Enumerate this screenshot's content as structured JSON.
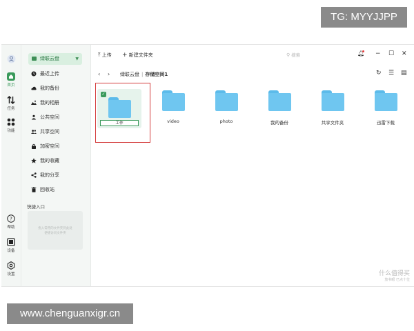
{
  "overlay": {
    "tg": "TG: MYYJJPP",
    "url": "www.chenguanxigr.cn"
  },
  "rail": [
    {
      "label": "",
      "icon": "user-icon"
    },
    {
      "label": "首页",
      "icon": "home-icon"
    },
    {
      "label": "任务",
      "icon": "transfer-icon"
    },
    {
      "label": "功能",
      "icon": "grid-icon"
    },
    {
      "label": "帮助",
      "icon": "help-icon"
    },
    {
      "label": "设备",
      "icon": "device-icon"
    },
    {
      "label": "设置",
      "icon": "settings-icon"
    }
  ],
  "sidebar": {
    "drive": "绿联云盘",
    "items": [
      {
        "label": "最近上传",
        "icon": "clock-icon"
      },
      {
        "label": "我的备份",
        "icon": "cloud-icon"
      },
      {
        "label": "我的相册",
        "icon": "photo-icon"
      },
      {
        "label": "公共空间",
        "icon": "public-icon"
      },
      {
        "label": "共享空间",
        "icon": "share-users-icon"
      },
      {
        "label": "加密空间",
        "icon": "lock-icon"
      },
      {
        "label": "我的收藏",
        "icon": "star-icon"
      },
      {
        "label": "我的分享",
        "icon": "share-icon"
      },
      {
        "label": "回收站",
        "icon": "trash-icon"
      }
    ],
    "quick_title": "快捷入口",
    "quick_hint_1": "拖入常用的文件夹到此处",
    "quick_hint_2": "便捷访问文件夹"
  },
  "toolbar": {
    "upload": "上传",
    "new_folder": "新建文件夹",
    "search_placeholder": "搜索"
  },
  "breadcrumb": {
    "root": "绿联云盘",
    "current": "存储空间1"
  },
  "folders": [
    {
      "name": "工作",
      "renaming": true
    },
    {
      "name": "video"
    },
    {
      "name": "photo"
    },
    {
      "name": "我的备份"
    },
    {
      "name": "共享文件夹"
    },
    {
      "name": "迅雷下载"
    }
  ],
  "watermark": {
    "main": "什么值得买",
    "sub": "放书眼 已点十位"
  },
  "colors": {
    "accent": "#3a9a5b",
    "folder": "#6fc6f0",
    "highlight": "#d43a3a"
  }
}
